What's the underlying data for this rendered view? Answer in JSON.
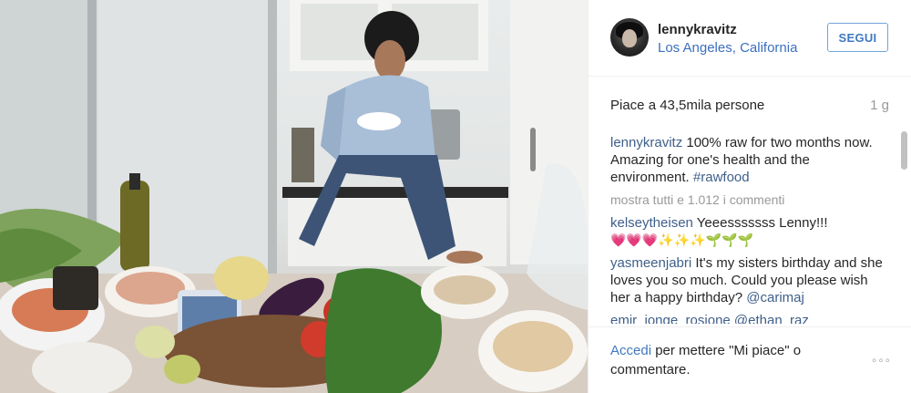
{
  "post": {
    "username": "lennykravitz",
    "location": "Los Angeles, California",
    "follow_label": "SEGUI",
    "likes": "Piace a 43,5mila persone",
    "time_ago": "1 g"
  },
  "caption": {
    "user": "lennykravitz",
    "text": " 100% raw for two months now. Amazing for one's health and the environment. ",
    "hashtag": "#rawfood"
  },
  "show_all_comments": "mostra tutti e 1.012 i commenti",
  "comments": [
    {
      "user": "kelseytheisen",
      "text": " Yeeesssssss Lenny!!! ",
      "emojis": "💗💗💗✨✨✨🌱🌱🌱"
    },
    {
      "user": "yasmeenjabri",
      "text": " It's my sisters birthday and she loves you so much. Could you please wish her a happy birthday? ",
      "mention": "@carimaj"
    },
    {
      "user": "emir_jonge_rosione",
      "text": " @ethan_raz"
    }
  ],
  "footer": {
    "login_link": "Accedi",
    "login_text": " per mettere \"Mi piace\" o commentare.",
    "more_icon": "ellipsis-icon"
  },
  "colors": {
    "link_blue": "#3f79c0",
    "username_blue": "#3f5f8a",
    "muted_gray": "#999999"
  }
}
